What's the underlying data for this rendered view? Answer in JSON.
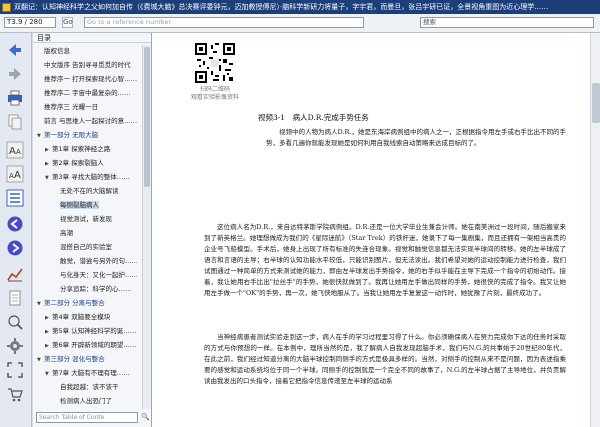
{
  "window": {
    "title": "双翻记：认知神经科学之父如何加自传（《费城大脑》总决赛评委钟元，迈加教授傅尼）·脑科学新研力将量子，字宇君，而曼旦，张吕宇研已证，全景视角重图为近心理学……"
  },
  "toolbar": {
    "page_indicator": "T3.9 / 280",
    "go_label": "Go",
    "reference_placeholder": "Go to a reference number",
    "search_placeholder": "搜索"
  },
  "left_toolbar": {
    "icons": [
      "back-arrow-icon",
      "forward-arrow-icon",
      "print-icon",
      "copy-icon",
      "font-larger-icon",
      "font-smaller-icon",
      "toc-lines-icon",
      "prev-page-icon",
      "next-page-icon",
      "chart-icon",
      "document-icon",
      "zoom-icon",
      "settings-gear-icon",
      "fullscreen-icon",
      "shopping-cart-icon"
    ]
  },
  "toc": {
    "header": "目录",
    "items": [
      {
        "label": "版权信息",
        "level": 1,
        "arrow": ""
      },
      {
        "label": "中文版序 告别寻寻觅觅的时代",
        "level": 1,
        "arrow": ""
      },
      {
        "label": "推荐序一 打开探索现代心智……",
        "level": 1,
        "arrow": ""
      },
      {
        "label": "推荐序二 宇宙中最复杂的……",
        "level": 1,
        "arrow": ""
      },
      {
        "label": "推荐序三 光耀一日",
        "level": 1,
        "arrow": ""
      },
      {
        "label": "前言 与思维人一起探讨的意……",
        "level": 1,
        "arrow": ""
      },
      {
        "label": "第一部分 无限大脑",
        "level": 1,
        "arrow": "▼"
      },
      {
        "label": "第1章 探索神经之路",
        "level": 2,
        "arrow": "▶"
      },
      {
        "label": "第2章 探索裂脑人",
        "level": 2,
        "arrow": "▶"
      },
      {
        "label": "第3章 寻找大脑的整体……",
        "level": 2,
        "arrow": "▼"
      },
      {
        "label": "无处不在的大脑解读",
        "level": 3,
        "arrow": ""
      },
      {
        "label": "每侧裂脑病人",
        "level": 3,
        "arrow": ""
      },
      {
        "label": "视觉测试，新发现",
        "level": 3,
        "arrow": ""
      },
      {
        "label": "高潮",
        "level": 3,
        "arrow": ""
      },
      {
        "label": "混搭自己的实验室",
        "level": 3,
        "arrow": ""
      },
      {
        "label": "触觉，谱尝与另外的句……",
        "level": 3,
        "arrow": ""
      },
      {
        "label": "与化身天：又化一起护……",
        "level": 3,
        "arrow": ""
      },
      {
        "label": "分享追踪：科学的心……",
        "level": 3,
        "arrow": ""
      },
      {
        "label": "第二部分 分离与整合",
        "level": 1,
        "arrow": "▼"
      },
      {
        "label": "第4章 双脑要全模块",
        "level": 2,
        "arrow": "▶"
      },
      {
        "label": "第5章 认知神经科学的诞……",
        "level": 2,
        "arrow": "▶"
      },
      {
        "label": "第6章 开辟新领域的期望……",
        "level": 2,
        "arrow": "▶"
      },
      {
        "label": "第三部分 混化与整合",
        "level": 1,
        "arrow": "▼"
      },
      {
        "label": "第7章 大脑有不理有理……",
        "level": 2,
        "arrow": "▼"
      },
      {
        "label": "自我超越：该不该干",
        "level": 3,
        "arrow": ""
      },
      {
        "label": "检测病人出恐门了",
        "level": 3,
        "arrow": ""
      }
    ],
    "selected_index": 11,
    "search_placeholder": "Search Table of Conte"
  },
  "document": {
    "qr_caption": "扫码二维码\n观看实验影像资料",
    "figure_caption": "视频3-1　病人D.R.完成手势任务",
    "figure_desc": "视频中的人物为病人D.R.，她是东海岸病例组中的病人之一，正根据指令用左手或右手比出不同的手势，多看几遍你就能发现她是如何利用自我线索自动策略来达成目标的了。",
    "paragraphs": [
      "这位病人名为D.R.，来自达特茅斯学院病例组。D.R.还是一位大学毕业生兼会计师。她在南美洲过一段时间，随后搬家来到了新英格兰。她理想做成为我们的《星际迷航》（Star Trek）的铁杆迷，她录下了每一集剧集，而且还拥有一架相当高贵的企业号飞船模型。手术后，她身上出现了所有标准的失连合现象。视觉和触觉信息都无法实现半球间的转移。她的左半球成了语言和言语的主导；右半球的认知功能水平较低，只能识别图片，但无法读出。我们希望对她的运动控制能力进行检查，我们试图通过一种简单的方式来测试她的能力，即由左半球发出手势指令，她的右手似乎能在主导下完成一个指令的初始动作。接着，我让她用右手比出\"拉丝手\"的手势，她很快就做到了。我再让她用左手做出同样的手势，她很快的完成了指令。我又让她用左手做一个\"OK\"的手势，再一次，她飞快地服从了。当我让她用左手复复这一动作时，她犹豫了片刻，最终成功了。",
      "当神经病患者测试实验走到这一步，病人在手的学习过程里习得了什么。你必须确保病人在努力完成你下达的任务时采取的方式与你预想的一样。在本例中，理所当然的是，我了解病人自我发现超脑手术，我们与N.G.的共事始于20世纪80年代，在此之前，我们经过知道分离的大脑半球控制同侧手的方式是极具多样的。当然，对侧手的控制从来不是问题，因为表述指乘要的感觉和运动系统均位于同一个半球。同侧手的控制就是一个完全不同的故事了，N.G.的左半球占据了主导地位，并负责解读由我发出的口头指令，接着它把指令信息传递至左半球的运动系"
    ]
  }
}
